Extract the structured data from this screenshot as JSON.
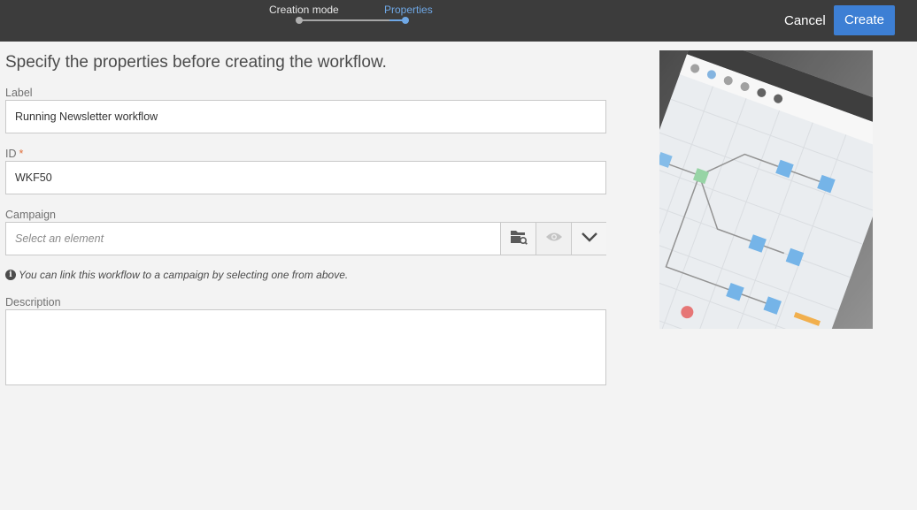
{
  "wizard": {
    "steps": [
      "Creation mode",
      "Properties"
    ],
    "active_step": "Properties",
    "cancel_label": "Cancel",
    "create_label": "Create"
  },
  "form": {
    "heading": "Specify the properties before creating the workflow.",
    "label_field": {
      "label": "Label",
      "value": "Running Newsletter workflow"
    },
    "id_field": {
      "label": "ID",
      "required_mark": "*",
      "value": "WKF50"
    },
    "campaign_field": {
      "label": "Campaign",
      "placeholder": "Select an element"
    },
    "info_text": "You can link this workflow to a campaign by selecting one from above.",
    "description_field": {
      "label": "Description",
      "value": ""
    }
  },
  "icons": {
    "folder_search": "folder-search-icon",
    "eye": "eye-icon",
    "chevron": "chevron-down-icon",
    "info": "info-icon"
  },
  "colors": {
    "topbar": "#3c3c3c",
    "accent": "#3d7fd4",
    "active_step": "#6fa8e6",
    "required": "#e0703c"
  }
}
